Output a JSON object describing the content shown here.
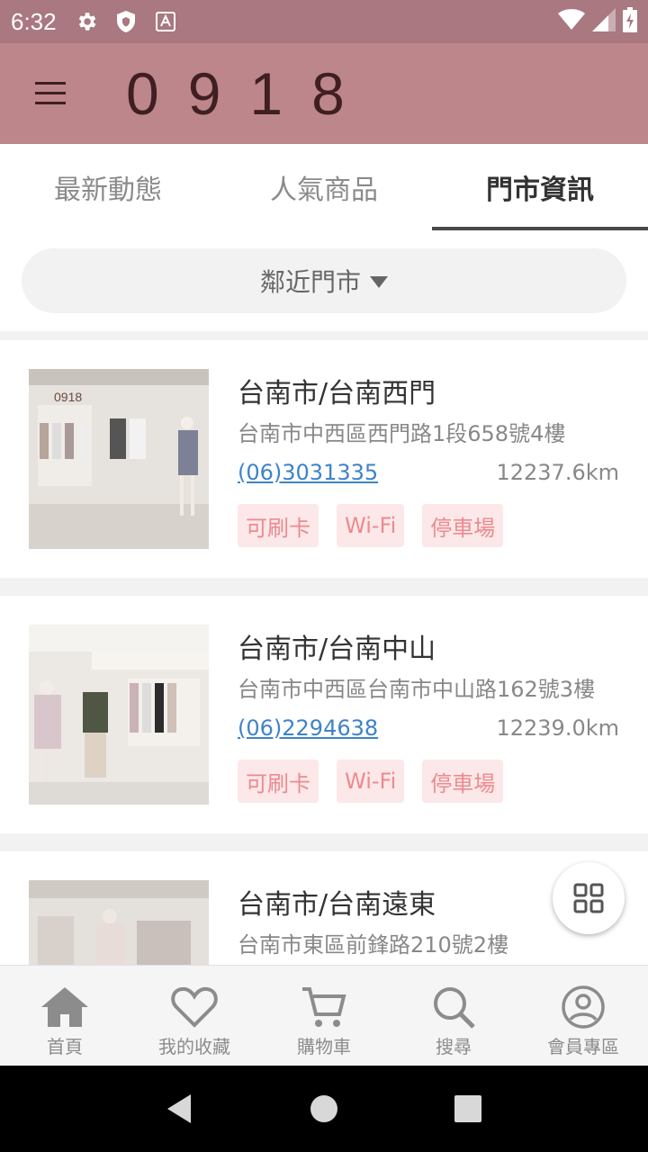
{
  "status_bar": {
    "time": "6:32",
    "icons": [
      "gear-icon",
      "shield-icon",
      "a-box-icon",
      "wifi-icon",
      "signal-icon",
      "battery-icon"
    ]
  },
  "app_bar": {
    "brand": "0918",
    "menu_icon": "hamburger-icon"
  },
  "tabs": [
    {
      "label": "最新動態",
      "active": false
    },
    {
      "label": "人氣商品",
      "active": false
    },
    {
      "label": "門市資訊",
      "active": true
    }
  ],
  "filter": {
    "label": "鄰近門市"
  },
  "stores": [
    {
      "name": "台南市/台南西門",
      "address": "台南市中西區西門路1段658號4樓",
      "phone": "(06)3031335",
      "distance": "12237.6km",
      "tags": [
        "可刷卡",
        "Wi-Fi",
        "停車場"
      ]
    },
    {
      "name": "台南市/台南中山",
      "address": "台南市中西區台南市中山路162號3樓",
      "phone": "(06)2294638",
      "distance": "12239.0km",
      "tags": [
        "可刷卡",
        "Wi-Fi",
        "停車場"
      ]
    },
    {
      "name": "台南市/台南遠東",
      "address": "台南市東區前鋒路210號2樓",
      "phone": "",
      "distance": "",
      "tags": []
    }
  ],
  "bottom_nav": [
    {
      "label": "首頁",
      "icon": "home-icon"
    },
    {
      "label": "我的收藏",
      "icon": "heart-icon"
    },
    {
      "label": "購物車",
      "icon": "cart-icon"
    },
    {
      "label": "搜尋",
      "icon": "search-icon"
    },
    {
      "label": "會員專區",
      "icon": "account-icon"
    }
  ],
  "colors": {
    "status_bar": "#a97880",
    "app_bar": "#bd868b",
    "brand_text": "#3f1f21",
    "phone_link": "#3f83c9",
    "tag_bg": "#fce8e8",
    "tag_text": "#ec8a90"
  }
}
